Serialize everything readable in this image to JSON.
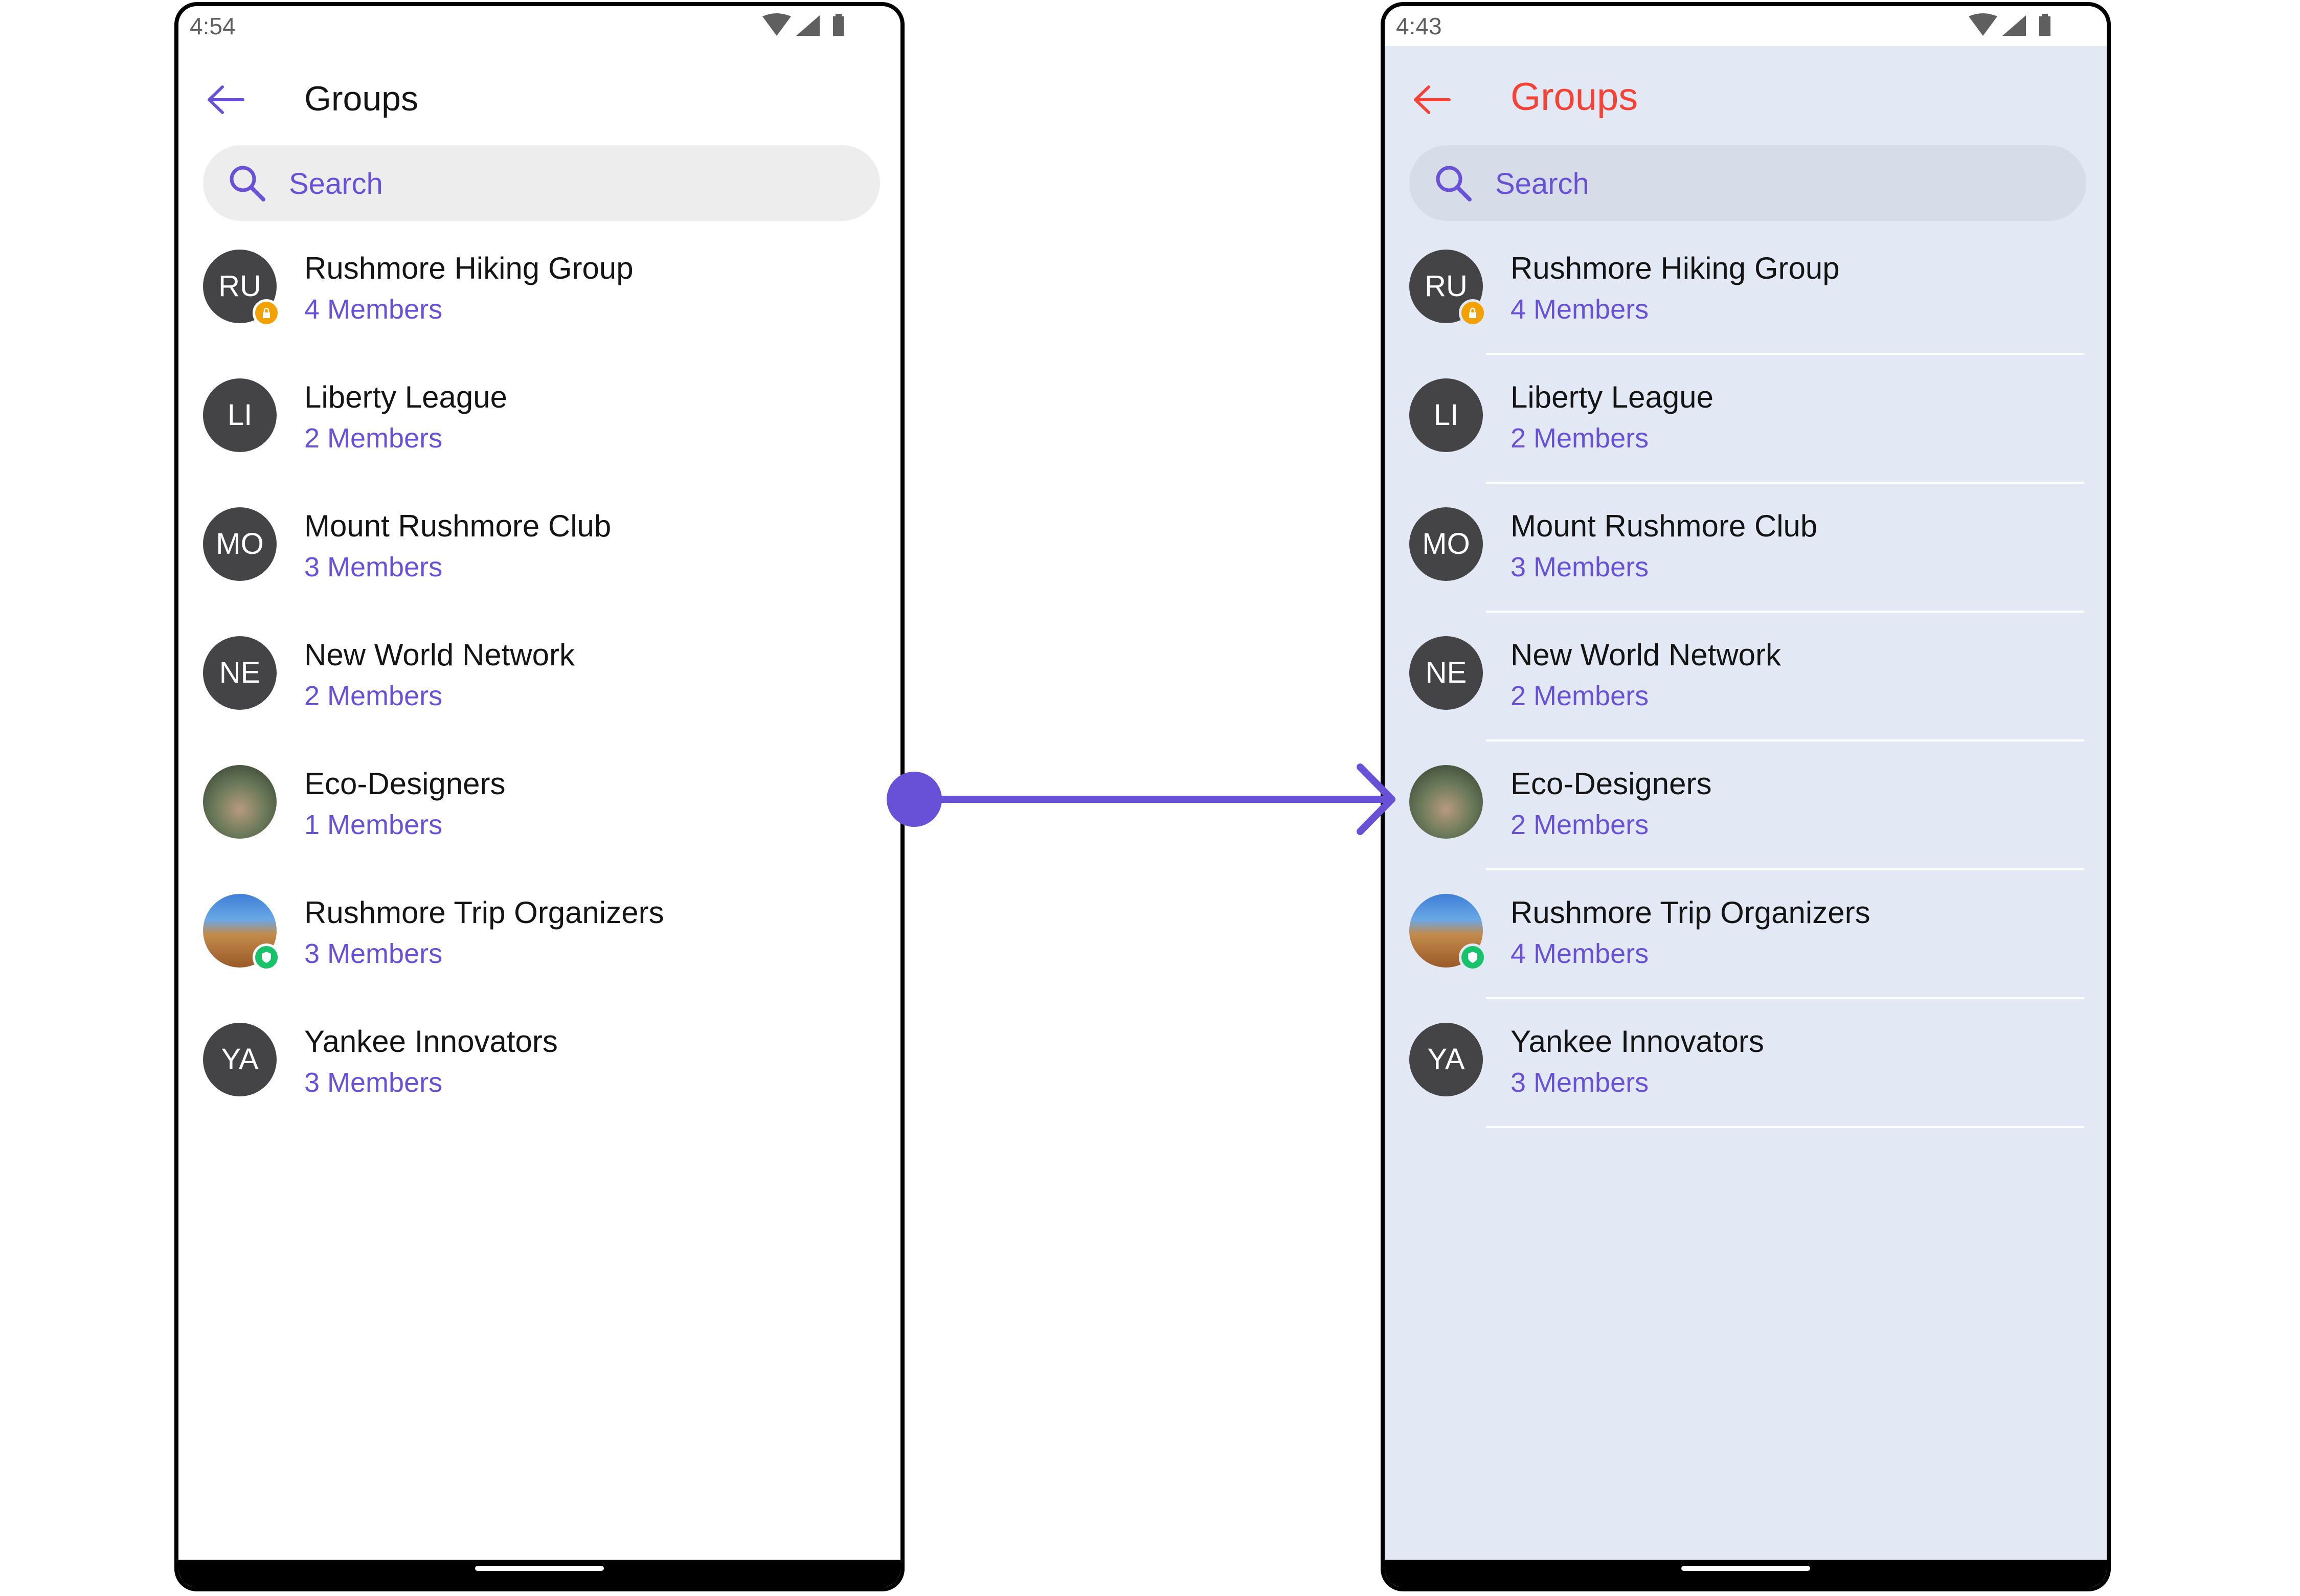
{
  "colors": {
    "accent": "#6851d6",
    "right_title": "#f44336",
    "right_background": "#e3e9f4",
    "avatar": "#444446",
    "badge_private": "#f2a100",
    "badge_protected": "#17c26b"
  },
  "left": {
    "status": {
      "time": "4:54"
    },
    "header": {
      "back_icon": "arrow-left-icon",
      "title": "Groups"
    },
    "search": {
      "icon": "search-icon",
      "placeholder": "Search"
    },
    "groups": [
      {
        "initials": "RU",
        "name": "Rushmore Hiking Group",
        "members": "4 Members",
        "badge": "private-lock"
      },
      {
        "initials": "LI",
        "name": "Liberty League",
        "members": "2 Members"
      },
      {
        "initials": "MO",
        "name": "Mount Rushmore Club",
        "members": "3 Members"
      },
      {
        "initials": "NE",
        "name": "New World Network",
        "members": "2 Members"
      },
      {
        "initials": "",
        "name": "Eco-Designers",
        "members": "1 Members",
        "avatar_image": "hands-with-plant-photo"
      },
      {
        "initials": "",
        "name": "Rushmore Trip Organizers",
        "members": "3 Members",
        "avatar_image": "mount-rushmore-photo",
        "badge": "protected-shield"
      },
      {
        "initials": "YA",
        "name": "Yankee Innovators",
        "members": "3 Members"
      }
    ]
  },
  "right": {
    "status": {
      "time": "4:43"
    },
    "header": {
      "back_icon": "arrow-left-icon",
      "title": "Groups"
    },
    "search": {
      "icon": "search-icon",
      "placeholder": "Search"
    },
    "groups": [
      {
        "initials": "RU",
        "name": "Rushmore Hiking Group",
        "members": "4 Members",
        "badge": "private-lock"
      },
      {
        "initials": "LI",
        "name": "Liberty League",
        "members": "2 Members"
      },
      {
        "initials": "MO",
        "name": "Mount Rushmore Club",
        "members": "3 Members"
      },
      {
        "initials": "NE",
        "name": "New World Network",
        "members": "2 Members"
      },
      {
        "initials": "",
        "name": "Eco-Designers",
        "members": "2 Members",
        "avatar_image": "hands-with-plant-photo"
      },
      {
        "initials": "",
        "name": "Rushmore Trip Organizers",
        "members": "4 Members",
        "avatar_image": "mount-rushmore-photo",
        "badge": "protected-shield"
      },
      {
        "initials": "YA",
        "name": "Yankee Innovators",
        "members": "3 Members"
      }
    ]
  }
}
